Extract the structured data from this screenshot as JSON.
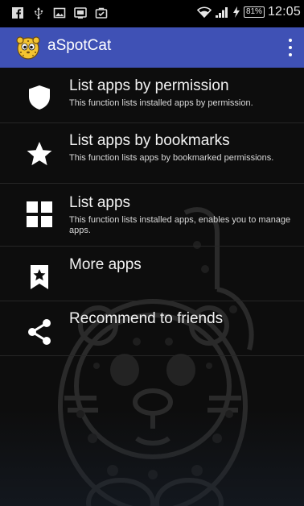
{
  "status_bar": {
    "left_icons": [
      "facebook-icon",
      "usb-icon",
      "image-icon",
      "screenshot-icon",
      "briefcase-icon"
    ],
    "battery_percent": "81%",
    "time": "12:05"
  },
  "app_bar": {
    "title": "aSpotCat",
    "logo_icon": "leopard-logo-icon",
    "menu_icon": "overflow-menu-icon",
    "background_color": "#3f51b5"
  },
  "menu_items": [
    {
      "icon": "shield-icon",
      "title": "List apps by permission",
      "description": "This function lists installed apps by permission."
    },
    {
      "icon": "star-icon",
      "title": "List apps by bookmarks",
      "description": "This function lists apps by bookmarked permissions."
    },
    {
      "icon": "grid-icon",
      "title": "List apps",
      "description": "This function lists installed apps, enables you to manage apps."
    },
    {
      "icon": "bookmark-star-icon",
      "title": "More apps",
      "description": ""
    },
    {
      "icon": "share-icon",
      "title": "Recommend to friends",
      "description": ""
    }
  ]
}
